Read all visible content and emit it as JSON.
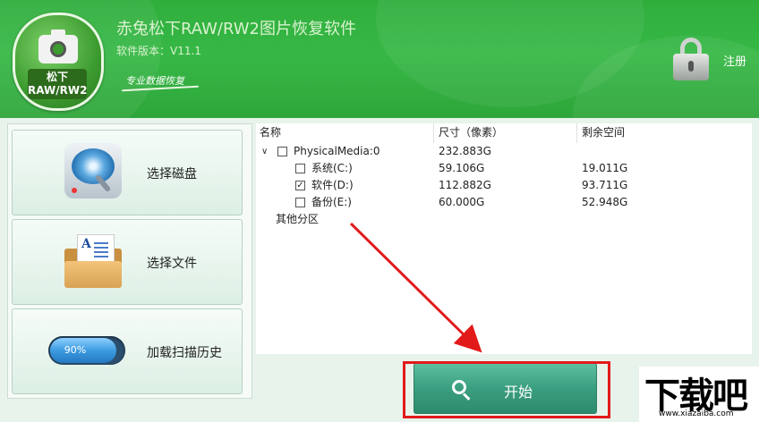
{
  "header": {
    "logo_line1": "松下",
    "logo_line2": "RAW/RW2",
    "title": "赤兔松下RAW/RW2图片恢复软件",
    "version": "软件版本：V11.1",
    "slogan": "专业数据恢复",
    "register_label": "注册"
  },
  "sidebar": {
    "items": [
      {
        "label": "选择磁盘",
        "icon": "disk-icon"
      },
      {
        "label": "选择文件",
        "icon": "folder-icon"
      },
      {
        "label": "加载扫描历史",
        "icon": "progress-icon",
        "progress_text": "90%",
        "progress": 0.9
      }
    ]
  },
  "table": {
    "columns": [
      "名称",
      "尺寸（像素）",
      "剩余空间"
    ],
    "rows": [
      {
        "name": "PhysicalMedia:0",
        "size": "232.883G",
        "free": "",
        "checked": false,
        "level": 0
      },
      {
        "name": "系统(C:)",
        "size": "59.106G",
        "free": "19.011G",
        "checked": false,
        "level": 1
      },
      {
        "name": "软件(D:)",
        "size": "112.882G",
        "free": "93.711G",
        "checked": true,
        "level": 1
      },
      {
        "name": "备份(E:)",
        "size": "60.000G",
        "free": "52.948G",
        "checked": false,
        "level": 1
      }
    ],
    "other_partition": "其他分区"
  },
  "start_button": {
    "label": "开始"
  },
  "watermark": {
    "text": "下载吧",
    "url": "www.xiazaiba.com"
  },
  "colors": {
    "header_green": "#37b846",
    "button_teal": "#3a9e80",
    "highlight_red": "#e21a1a"
  }
}
